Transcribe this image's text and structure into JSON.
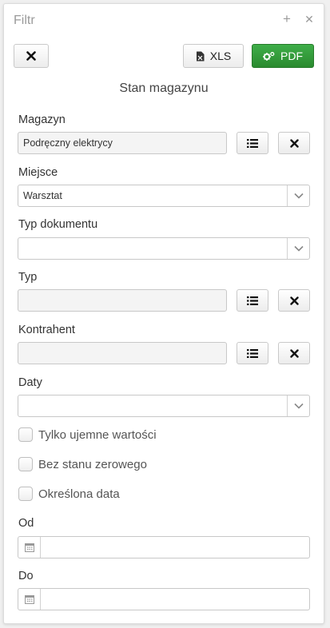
{
  "window": {
    "title": "Filtr",
    "add_icon": "+",
    "close_icon": "✕"
  },
  "toolbar": {
    "close_icon": "close-icon",
    "xls_label": "XLS",
    "pdf_label": "PDF",
    "pdf_color": "#2f9a35"
  },
  "section_title": "Stan magazynu",
  "fields": {
    "magazyn": {
      "label": "Magazyn",
      "value": "Podręczny elektrycy"
    },
    "miejsce": {
      "label": "Miejsce",
      "value": "Warsztat"
    },
    "typ_dokumentu": {
      "label": "Typ dokumentu",
      "value": ""
    },
    "typ": {
      "label": "Typ",
      "value": ""
    },
    "kontrahent": {
      "label": "Kontrahent",
      "value": ""
    },
    "daty": {
      "label": "Daty",
      "value": ""
    },
    "od": {
      "label": "Od",
      "value": ""
    },
    "do": {
      "label": "Do",
      "value": ""
    }
  },
  "checkboxes": {
    "ujemne": {
      "label": "Tylko ujemne wartości",
      "checked": false
    },
    "bez_zera": {
      "label": "Bez stanu zerowego",
      "checked": false
    },
    "data": {
      "label": "Określona data",
      "checked": false
    }
  }
}
